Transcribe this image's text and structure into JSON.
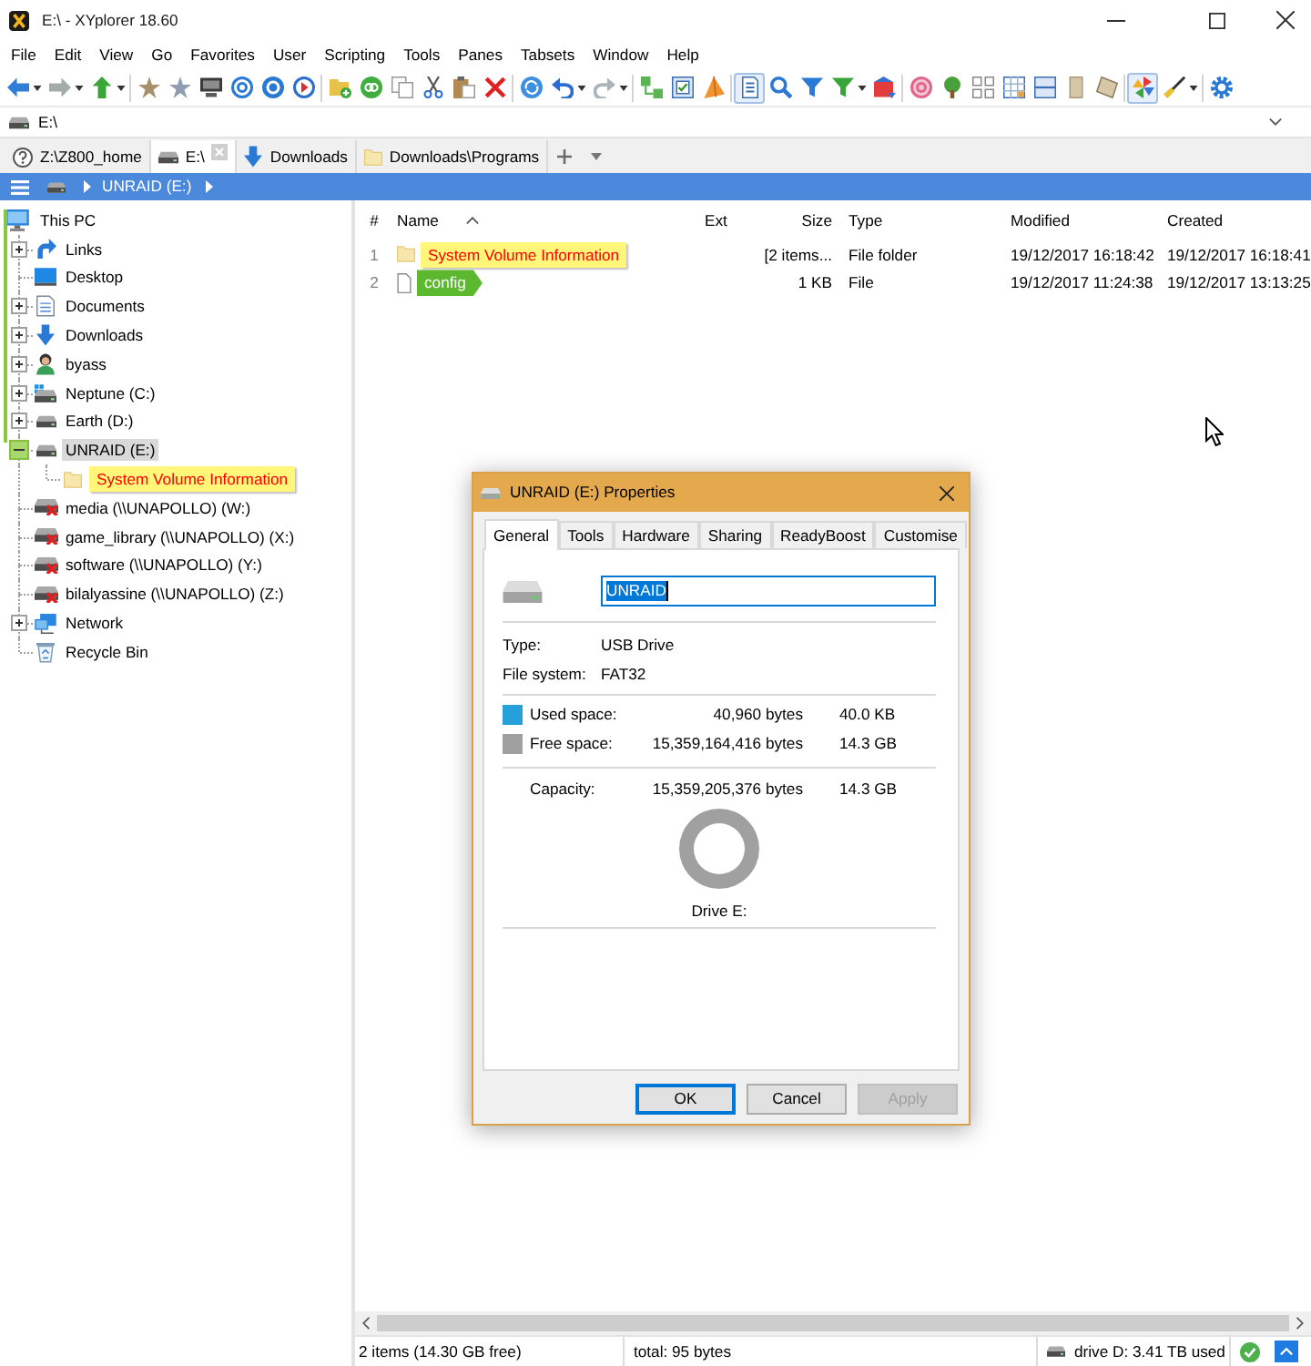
{
  "window": {
    "title": "E:\\ - XYplorer 18.60"
  },
  "menu": [
    "File",
    "Edit",
    "View",
    "Go",
    "Favorites",
    "User",
    "Scripting",
    "Tools",
    "Panes",
    "Tabsets",
    "Window",
    "Help"
  ],
  "toolbar": {
    "groups": [
      {
        "buttons": [
          {
            "pressed": false
          },
          {
            "pressed": false
          },
          {
            "pressed": false
          }
        ]
      },
      {
        "buttons": [
          {
            "pressed": false
          },
          {
            "pressed": false
          },
          {
            "pressed": false
          },
          {
            "pressed": false
          },
          {
            "pressed": false
          },
          {
            "pressed": false
          }
        ]
      },
      {
        "buttons": [
          {
            "pressed": false
          },
          {
            "pressed": false
          },
          {
            "pressed": false
          },
          {
            "pressed": false
          },
          {
            "pressed": false
          },
          {
            "pressed": false
          }
        ]
      },
      {
        "buttons": [
          {
            "pressed": false
          },
          {
            "pressed": false
          },
          {
            "pressed": false
          }
        ]
      },
      {
        "buttons": [
          {
            "pressed": false
          },
          {
            "pressed": false
          },
          {
            "pressed": false
          }
        ]
      },
      {
        "buttons": [
          {
            "pressed": true
          },
          {
            "pressed": false
          },
          {
            "pressed": false
          },
          {
            "pressed": false
          },
          {
            "pressed": false
          }
        ]
      },
      {
        "buttons": [
          {
            "pressed": false
          },
          {
            "pressed": false
          },
          {
            "pressed": false
          },
          {
            "pressed": false
          },
          {
            "pressed": false
          },
          {
            "pressed": false
          },
          {
            "pressed": false
          }
        ]
      },
      {
        "buttons": [
          {
            "pressed": true
          },
          {
            "pressed": false
          }
        ]
      },
      {
        "buttons": [
          {
            "pressed": false
          }
        ]
      }
    ]
  },
  "address_bar": {
    "value": "E:\\"
  },
  "tabs": [
    {
      "label": "Z:\\Z800_home",
      "kind": "unavailable",
      "selected": false
    },
    {
      "label": "E:\\",
      "kind": "drive",
      "selected": true
    },
    {
      "label": "Downloads",
      "kind": "downloads",
      "selected": false
    },
    {
      "label": "Downloads\\Programs",
      "kind": "folder",
      "selected": false
    }
  ],
  "breadcrumb": [
    "UNRAID (E:)"
  ],
  "tree": [
    {
      "label": "This PC",
      "kind": "computer",
      "selected": false,
      "children": [
        {
          "label": "Links",
          "kind": "links",
          "expanded": false,
          "selected": false
        },
        {
          "label": "Desktop",
          "kind": "desktop",
          "selected": false
        },
        {
          "label": "Documents",
          "kind": "documents",
          "expanded": false,
          "selected": false
        },
        {
          "label": "Downloads",
          "kind": "downloads",
          "expanded": false,
          "selected": false
        },
        {
          "label": "byass",
          "kind": "user",
          "expanded": false,
          "selected": false
        },
        {
          "label": "Neptune (C:)",
          "kind": "system_drive",
          "expanded": false,
          "selected": false
        },
        {
          "label": "Earth (D:)",
          "kind": "drive",
          "expanded": false,
          "selected": false
        },
        {
          "label": "UNRAID (E:)",
          "kind": "drive",
          "expanded": true,
          "selected": true,
          "children": [
            {
              "label": "System Volume Information",
              "kind": "folder",
              "selected": false,
              "highlight": {
                "kind": "box",
                "color": "#fff67a",
                "foreground": {
                  "color": "#ff0000"
                }
              }
            }
          ]
        },
        {
          "label": "media (\\\\UNAPOLLO) (W:)",
          "kind": "disconnected_drive",
          "selected": false
        },
        {
          "label": "game_library (\\\\UNAPOLLO) (X:)",
          "kind": "disconnected_drive",
          "selected": false
        },
        {
          "label": "software (\\\\UNAPOLLO) (Y:)",
          "kind": "disconnected_drive",
          "selected": false
        },
        {
          "label": "bilalyassine (\\\\UNAPOLLO) (Z:)",
          "kind": "disconnected_drive",
          "selected": false
        },
        {
          "label": "Network",
          "kind": "network",
          "expanded": false,
          "selected": false
        },
        {
          "label": "Recycle Bin",
          "kind": "recycle_bin",
          "selected": false
        }
      ]
    }
  ],
  "file_list": {
    "columns": [
      {
        "label": "#",
        "sorted": false
      },
      {
        "label": "Name",
        "sorted": true
      },
      {
        "label": "Ext",
        "sorted": false
      },
      {
        "label": "Size",
        "sorted": false
      },
      {
        "label": "Type",
        "sorted": false
      },
      {
        "label": "Modified",
        "sorted": false
      },
      {
        "label": "Created",
        "sorted": false
      }
    ],
    "rows": [
      {
        "number": "1",
        "kind": "folder",
        "name": "System Volume Information",
        "size": "[2 items...",
        "type": "File folder",
        "modified": "19/12/2017 16:18:42",
        "created": "19/12/2017 16:18:41",
        "selected": false,
        "highlight": {
          "kind": "box",
          "color": "#fff67a",
          "foreground": {
            "color": "#ff0000"
          }
        }
      },
      {
        "number": "2",
        "kind": "file",
        "name": "config",
        "size": "1 KB",
        "type": "File",
        "modified": "19/12/2017 11:24:38",
        "created": "19/12/2017 13:13:25",
        "selected": false,
        "highlight": {
          "kind": "tag",
          "color": "#5cb82e",
          "foreground": {
            "color": "#ffffff"
          }
        }
      }
    ]
  },
  "status_bar": {
    "items": "2 items (14.30 GB free)",
    "total": "total: 95 bytes",
    "drive": "drive D: 3.41 TB used"
  },
  "dialog": {
    "title": "UNRAID (E:) Properties",
    "tabs": [
      {
        "label": "General",
        "selected": true
      },
      {
        "label": "Tools",
        "selected": false
      },
      {
        "label": "Hardware",
        "selected": false
      },
      {
        "label": "Sharing",
        "selected": false
      },
      {
        "label": "ReadyBoost",
        "selected": false
      },
      {
        "label": "Customise",
        "selected": false
      }
    ],
    "name_field": {
      "value": "UNRAID",
      "text_selected": true
    },
    "info": [
      {
        "label": "Type:",
        "value": "USB Drive"
      },
      {
        "label": "File system:",
        "value": "FAT32"
      }
    ],
    "space": [
      {
        "label": "Used space:",
        "bytes": "40,960 bytes",
        "size": "40.0 KB",
        "color": "#26a0da"
      },
      {
        "label": "Free space:",
        "bytes": "15,359,164,416 bytes",
        "size": "14.3 GB",
        "color": "#a0a0a0"
      }
    ],
    "capacity": {
      "label": "Capacity:",
      "bytes": "15,359,205,376 bytes",
      "size": "14.3 GB"
    },
    "drive_label": "Drive E:",
    "buttons": [
      {
        "label": "OK",
        "default": true,
        "disabled": false
      },
      {
        "label": "Cancel",
        "default": false,
        "disabled": false
      },
      {
        "label": "Apply",
        "default": false,
        "disabled": true
      }
    ]
  }
}
